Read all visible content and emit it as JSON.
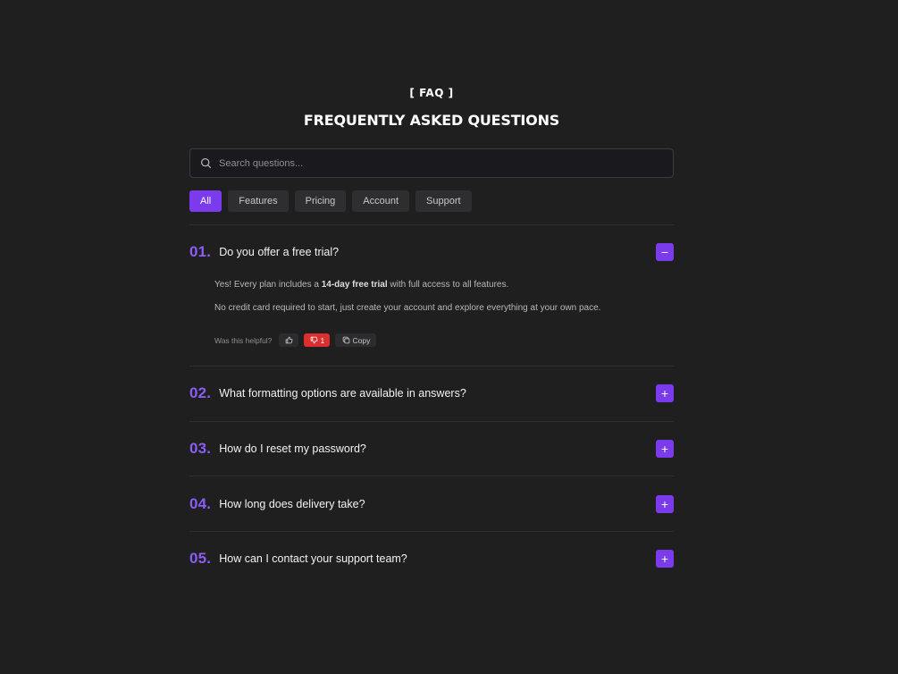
{
  "header": {
    "eyebrow": "[ FAQ ]",
    "title": "FREQUENTLY ASKED QUESTIONS"
  },
  "search": {
    "placeholder": "Search questions...",
    "value": ""
  },
  "tabs": [
    {
      "label": "All",
      "active": true
    },
    {
      "label": "Features",
      "active": false
    },
    {
      "label": "Pricing",
      "active": false
    },
    {
      "label": "Account",
      "active": false
    },
    {
      "label": "Support",
      "active": false
    }
  ],
  "faqs": [
    {
      "num": "01.",
      "question": "Do you offer a free trial?",
      "expanded": true,
      "toggle_symbol": "−",
      "answer": {
        "p1_before": "Yes! Every plan includes a ",
        "p1_bold": "14-day free trial",
        "p1_after": " with full access to all features.",
        "p2": "No credit card required to start, just create your account and explore everything at your own pace."
      },
      "feedback": {
        "label": "Was this helpful?",
        "dislike_count": "1",
        "copy_label": "Copy"
      }
    },
    {
      "num": "02.",
      "question": "What formatting options are available in answers?",
      "expanded": false,
      "toggle_symbol": "+"
    },
    {
      "num": "03.",
      "question": "How do I reset my password?",
      "expanded": false,
      "toggle_symbol": "+"
    },
    {
      "num": "04.",
      "question": "How long does delivery take?",
      "expanded": false,
      "toggle_symbol": "+"
    },
    {
      "num": "05.",
      "question": "How can I contact your support team?",
      "expanded": false,
      "toggle_symbol": "+"
    }
  ],
  "colors": {
    "accent": "#7c3aed",
    "accent_text": "#8b5cf6",
    "background": "#1f1f1f",
    "dislike_active": "#dc2e2e"
  },
  "icons": {
    "search": "search-icon",
    "thumbs_up": "thumbs-up-icon",
    "thumbs_down": "thumbs-down-icon",
    "copy": "copy-icon"
  }
}
